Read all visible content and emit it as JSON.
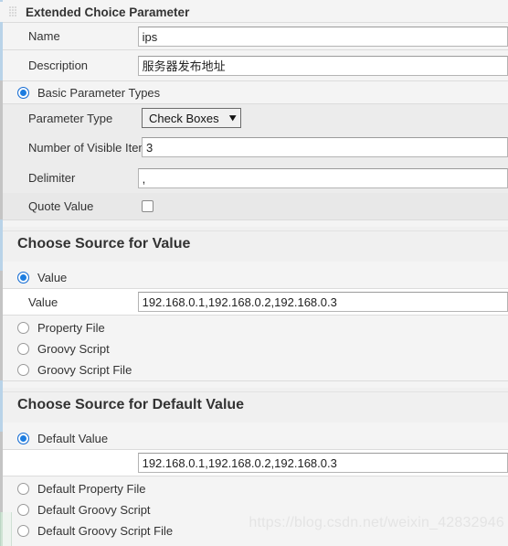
{
  "panel": {
    "title": "Extended Choice Parameter",
    "drag_handle_icon": "drag-grid-icon"
  },
  "basic_fields": [
    {
      "label": "Name",
      "value": "ips"
    },
    {
      "label": "Description",
      "value": "服务器发布地址"
    }
  ],
  "basic_parameter_types": {
    "radio_label": "Basic Parameter Types",
    "selected": true,
    "rows": {
      "parameter_type": {
        "label": "Parameter Type",
        "value": "Check Boxes",
        "caret_icon": "chevron-down-icon"
      },
      "visible_items": {
        "label": "Number of Visible Items",
        "value": "3"
      },
      "delimiter": {
        "label": "Delimiter",
        "value": ","
      },
      "quote_value": {
        "label": "Quote Value",
        "checked": false
      }
    }
  },
  "choose_source_for_value": {
    "heading": "Choose Source for Value",
    "options": [
      {
        "label": "Value",
        "selected": true
      },
      {
        "label": "Property File",
        "selected": false
      },
      {
        "label": "Groovy Script",
        "selected": false
      },
      {
        "label": "Groovy Script File",
        "selected": false
      }
    ],
    "value_row": {
      "label": "Value",
      "value": "192.168.0.1,192.168.0.2,192.168.0.3"
    }
  },
  "choose_source_for_default_value": {
    "heading": "Choose Source for Default Value",
    "options": [
      {
        "label": "Default Value",
        "selected": true
      },
      {
        "label": "Default Property File",
        "selected": false
      },
      {
        "label": "Default Groovy Script",
        "selected": false
      },
      {
        "label": "Default Groovy Script File",
        "selected": false
      }
    ],
    "value_row": {
      "value": "192.168.0.1,192.168.0.2,192.168.0.3"
    }
  },
  "watermark": "https://blog.csdn.net/weixin_42832946",
  "colors": {
    "accent_blue": "#1d7de0",
    "rail_blue": "#b9d3e8",
    "rail_grey": "#c4c4c4",
    "rail_green": "#cfe3d4",
    "panel_bg": "#f4f4f4",
    "band_grey": "#ececec"
  }
}
